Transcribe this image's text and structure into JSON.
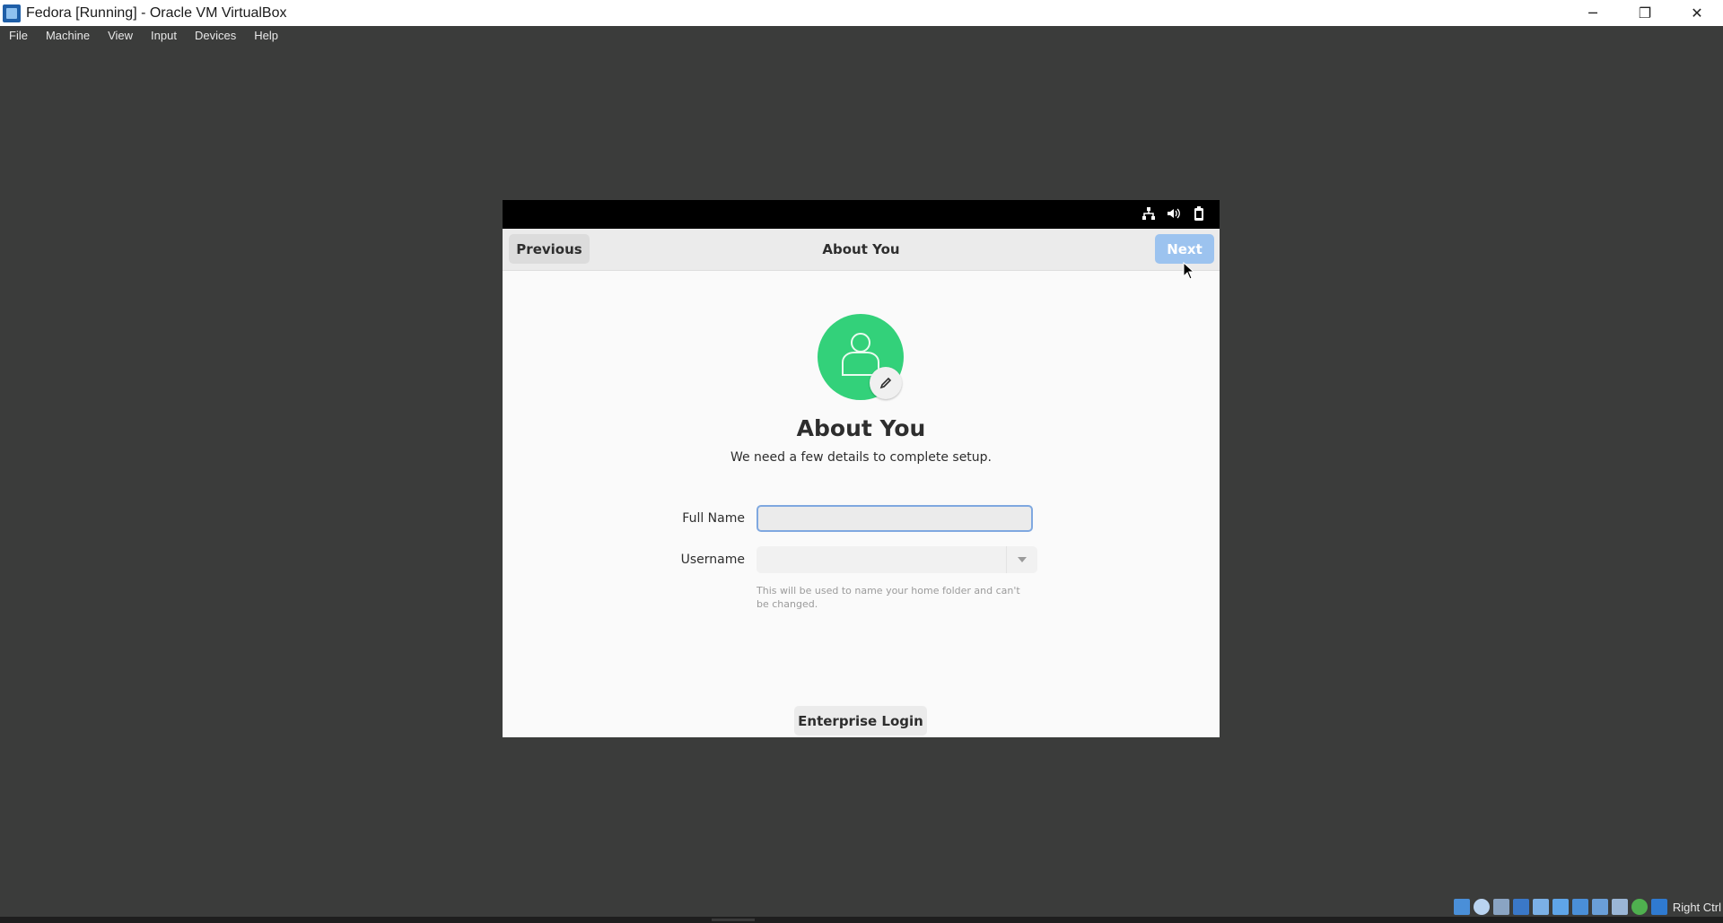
{
  "window": {
    "title": "Fedora [Running] - Oracle VM VirtualBox",
    "controls": {
      "minimize": "─",
      "restore": "❐",
      "close": "✕"
    }
  },
  "menubar": {
    "items": [
      "File",
      "Machine",
      "View",
      "Input",
      "Devices",
      "Help"
    ]
  },
  "guest": {
    "topbar_icons": [
      "network-icon",
      "volume-icon",
      "battery-icon"
    ],
    "header": {
      "previous_label": "Previous",
      "title": "About You",
      "next_label": "Next",
      "next_enabled": false
    },
    "page": {
      "title": "About You",
      "subtitle": "We need a few details to complete setup.",
      "full_name": {
        "label": "Full Name",
        "value": ""
      },
      "username": {
        "label": "Username",
        "value": ""
      },
      "hint": "This will be used to name your home folder and can't be changed.",
      "enterprise_login_label": "Enterprise Login"
    },
    "colors": {
      "avatar": "#33d17a",
      "next_button": "#9cc3ef",
      "focus_border": "#7fa8e0"
    }
  },
  "statusbar": {
    "icons": [
      "hard-disk-icon",
      "optical-drive-icon",
      "audio-icon",
      "network-status-icon",
      "usb-icon",
      "shared-folders-icon",
      "display-icon",
      "recording-icon",
      "cpu-icon",
      "mouse-integration-icon",
      "keyboard-icon"
    ],
    "host_key": "Right Ctrl"
  }
}
